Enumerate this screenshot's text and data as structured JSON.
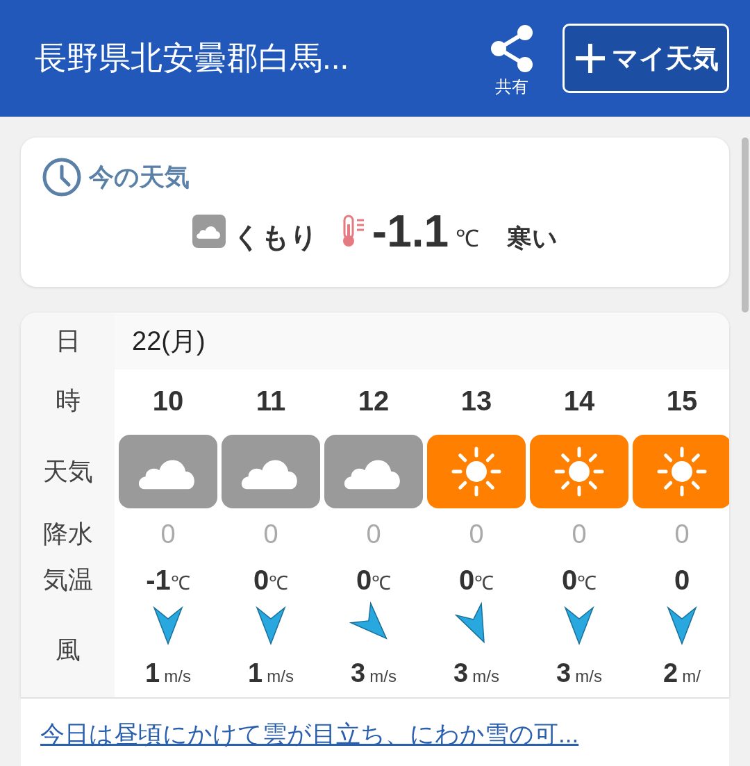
{
  "header": {
    "title": "長野県北安曇郡白馬...",
    "share_label": "共有",
    "my_weather_button": "マイ天気"
  },
  "current": {
    "title": "今の天気",
    "weather": "くもり",
    "kind": "cloudy",
    "temperature": "-1.1",
    "unit": "℃",
    "feel": "寒い"
  },
  "forecast": {
    "labels": {
      "day": "日",
      "hour": "時",
      "weather": "天気",
      "precip": "降水",
      "temp": "気温",
      "wind": "風"
    },
    "day": "22(月)",
    "hours": [
      {
        "hour": "10",
        "kind": "cloudy",
        "precip": "0",
        "temp": "-1",
        "temp_unit": "℃",
        "wind_arrow": {
          "kind": "north"
        },
        "wind": "1",
        "wind_unit": "m/s"
      },
      {
        "hour": "11",
        "kind": "cloudy",
        "precip": "0",
        "temp": "0",
        "temp_unit": "℃",
        "wind_arrow": {
          "kind": "north"
        },
        "wind": "1",
        "wind_unit": "m/s"
      },
      {
        "hour": "12",
        "kind": "cloudy",
        "precip": "0",
        "temp": "0",
        "temp_unit": "℃",
        "wind_arrow": {
          "kind": "northwest"
        },
        "wind": "3",
        "wind_unit": "m/s"
      },
      {
        "hour": "13",
        "kind": "sunny",
        "precip": "0",
        "temp": "0",
        "temp_unit": "℃",
        "wind_arrow": {
          "kind": "north-northwest"
        },
        "wind": "3",
        "wind_unit": "m/s"
      },
      {
        "hour": "14",
        "kind": "sunny",
        "precip": "0",
        "temp": "0",
        "temp_unit": "℃",
        "wind_arrow": {
          "kind": "north"
        },
        "wind": "3",
        "wind_unit": "m/s"
      },
      {
        "hour": "15",
        "kind": "sunny",
        "precip": "0",
        "temp": "0",
        "wind_arrow": {
          "kind": "north"
        },
        "wind": "2",
        "wind_unit": "m/"
      }
    ],
    "summary_link": "今日は昼頃にかけて雲が目立ち、にわか雪の可..."
  }
}
